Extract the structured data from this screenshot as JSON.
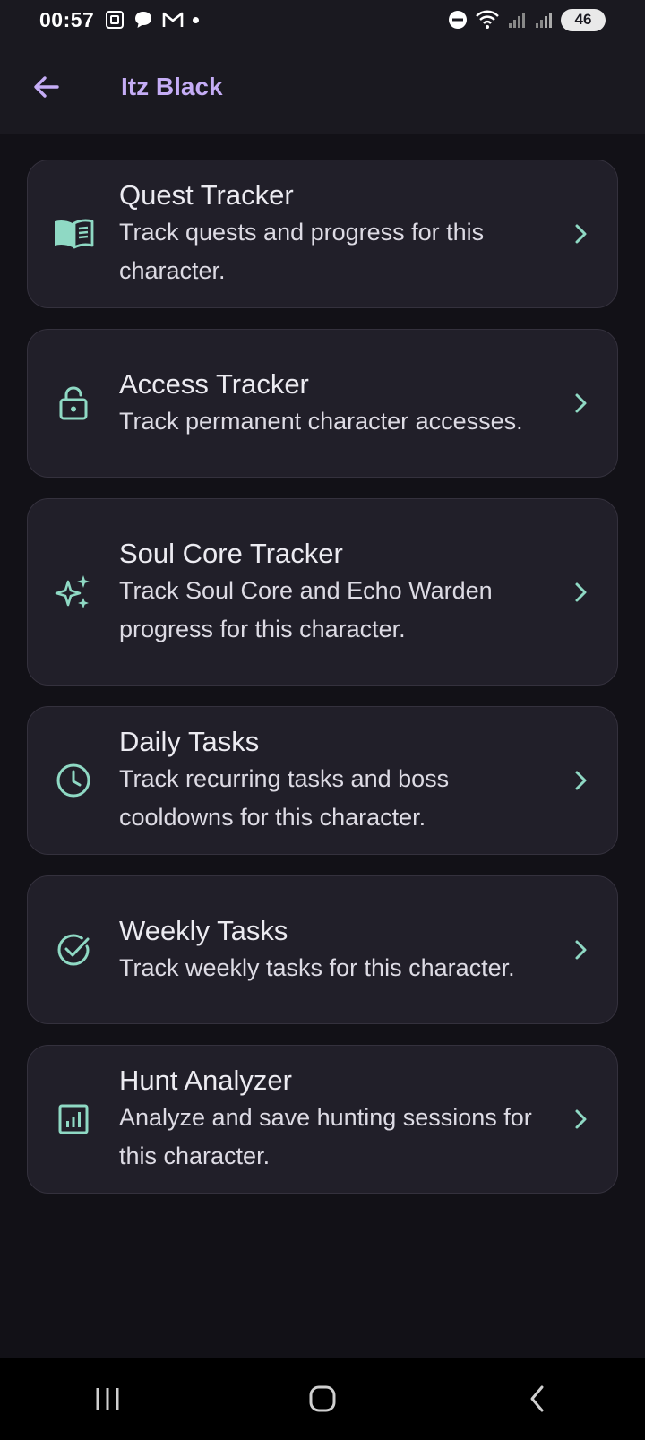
{
  "status_bar": {
    "time": "00:57",
    "battery": "46",
    "icons": [
      "screenshot-icon",
      "chat-icon",
      "gmail-icon",
      "dot-icon",
      "dnd-icon",
      "wifi-icon",
      "signal-icon",
      "signal-icon-2",
      "battery-icon"
    ]
  },
  "app_bar": {
    "title": "Itz Black",
    "back_icon": "arrow-left-icon"
  },
  "colors": {
    "accent": "#c5adf6",
    "icon_teal": "#8fd9c4",
    "card_bg": "#211f29",
    "background": "#121117"
  },
  "items": [
    {
      "title": "Quest Tracker",
      "description": "Track quests and progress for this character.",
      "icon": "book-icon"
    },
    {
      "title": "Access Tracker",
      "description": "Track permanent character accesses.",
      "icon": "lock-icon"
    },
    {
      "title": "Soul Core Tracker",
      "description": "Track Soul Core and Echo Warden progress for this character.",
      "icon": "sparkle-icon"
    },
    {
      "title": "Daily Tasks",
      "description": "Track recurring tasks and boss cooldowns for this character.",
      "icon": "clock-icon"
    },
    {
      "title": "Weekly Tasks",
      "description": "Track weekly tasks for this character.",
      "icon": "check-circle-icon"
    },
    {
      "title": "Hunt Analyzer",
      "description": "Analyze and save hunting sessions for this character.",
      "icon": "chart-icon"
    }
  ],
  "nav_bar": {
    "buttons": [
      "recent-apps-icon",
      "home-icon",
      "back-icon"
    ]
  }
}
